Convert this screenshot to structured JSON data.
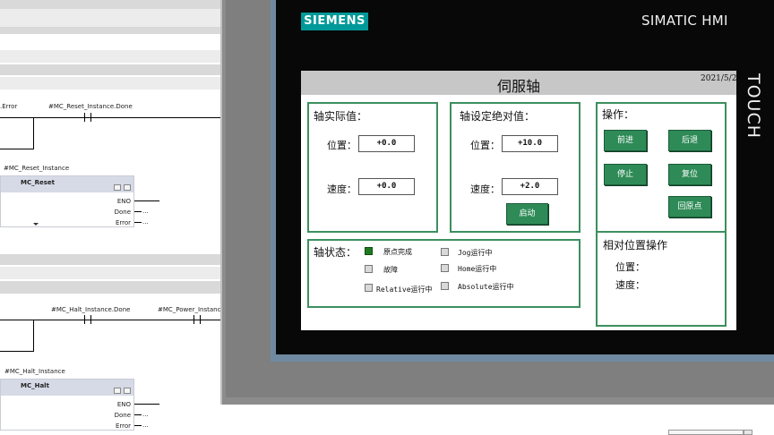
{
  "ladder": {
    "net1": {
      "error_tag": ".Error",
      "done_tag": "#MC_Reset_Instance.Done",
      "instance": "#MC_Reset_Instance",
      "block": "MC_Reset",
      "pins": [
        "ENO",
        "Done",
        "Error"
      ],
      "ellipsis": "..."
    },
    "net2": {
      "done_tag": "#MC_Halt_Instance.Done",
      "power_tag": "#MC_Power_Instance",
      "instance": "#MC_Halt_Instance",
      "block": "MC_Halt",
      "pins": [
        "ENO",
        "Done",
        "Error"
      ],
      "ellipsis": "..."
    }
  },
  "hmi": {
    "brand": "SIEMENS",
    "model": "SIMATIC HMI",
    "touch": "TOUCH",
    "colors": {
      "brand": "#009999",
      "group_border": "#3d8f5f",
      "button": "#2e8b57",
      "indicator_on": "#1f7a1f",
      "indicator_off": "#d9d9d9"
    },
    "screen": {
      "title": "伺服轴",
      "date": "2021/5/2",
      "actual": {
        "heading": "轴实际值：",
        "position_label": "位置：",
        "position_value": "+0.0",
        "speed_label": "速度：",
        "speed_value": "+0.0"
      },
      "setpoint": {
        "heading": "轴设定绝对值：",
        "position_label": "位置：",
        "position_value": "+10.0",
        "speed_label": "速度：",
        "speed_value": "+2.0",
        "start_button": "启动"
      },
      "operation": {
        "heading": "操作：",
        "buttons": {
          "forward": "前进",
          "backward": "后退",
          "stop": "停止",
          "reset": "复位",
          "home": "回原点"
        }
      },
      "status": {
        "heading": "轴状态：",
        "items": [
          {
            "label": "原点完成",
            "active": true
          },
          {
            "label": "Jog运行中",
            "active": false
          },
          {
            "label": "故障",
            "active": false
          },
          {
            "label": "Home运行中",
            "active": false
          },
          {
            "label": "Relative运行中",
            "active": false
          },
          {
            "label": "Absolute运行中",
            "active": false
          }
        ]
      },
      "relative": {
        "heading": "相对位置操作",
        "position_label": "位置：",
        "speed_label": "速度："
      }
    }
  }
}
